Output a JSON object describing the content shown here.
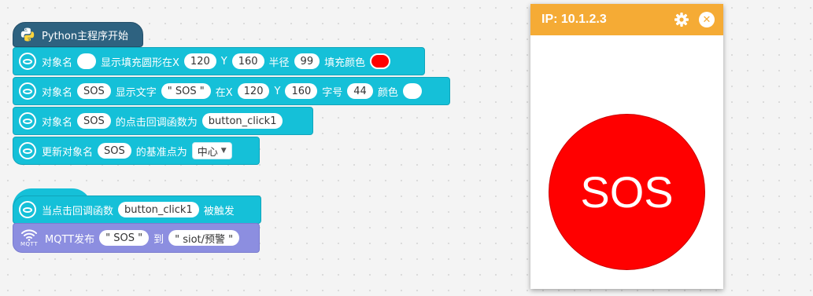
{
  "workspace": {
    "python_start": {
      "label": "Python主程序开始",
      "icon": "python-icon"
    },
    "fill_circle": {
      "obj_label": "对象名",
      "obj_value": "",
      "text": "显示填充圆形在X",
      "x": "120",
      "y_label": "Y",
      "y": "160",
      "radius_label": "半径",
      "radius": "99",
      "fill_label": "填充颜色",
      "fill_color": "#ff0000"
    },
    "show_text": {
      "obj_label": "对象名",
      "obj_value": "SOS",
      "text_label": "显示文字",
      "text_value": "\" SOS \"",
      "x_label": "在X",
      "x": "120",
      "y_label": "Y",
      "y": "160",
      "size_label": "字号",
      "size": "44",
      "color_label": "颜色",
      "color": "#ffffff"
    },
    "click_cb": {
      "obj_label": "对象名",
      "obj_value": "SOS",
      "text": "的点击回调函数为",
      "func": "button_click1"
    },
    "update_anchor": {
      "text": "更新对象名",
      "obj_value": "SOS",
      "text2": "的基准点为",
      "anchor": "中心"
    },
    "event_hat": {
      "text": "当点击回调函数",
      "func": "button_click1",
      "text2": "被触发"
    },
    "mqtt_publish": {
      "icon_label": "MQTT",
      "text": "MQTT发布",
      "message": "\" SOS \"",
      "to_label": "到",
      "topic": "\" siot/预警 \""
    }
  },
  "panel": {
    "title": "IP: 10.1.2.3",
    "header_color": "#f5ab35",
    "circle_color": "#ff0000",
    "circle_text": "SOS"
  }
}
